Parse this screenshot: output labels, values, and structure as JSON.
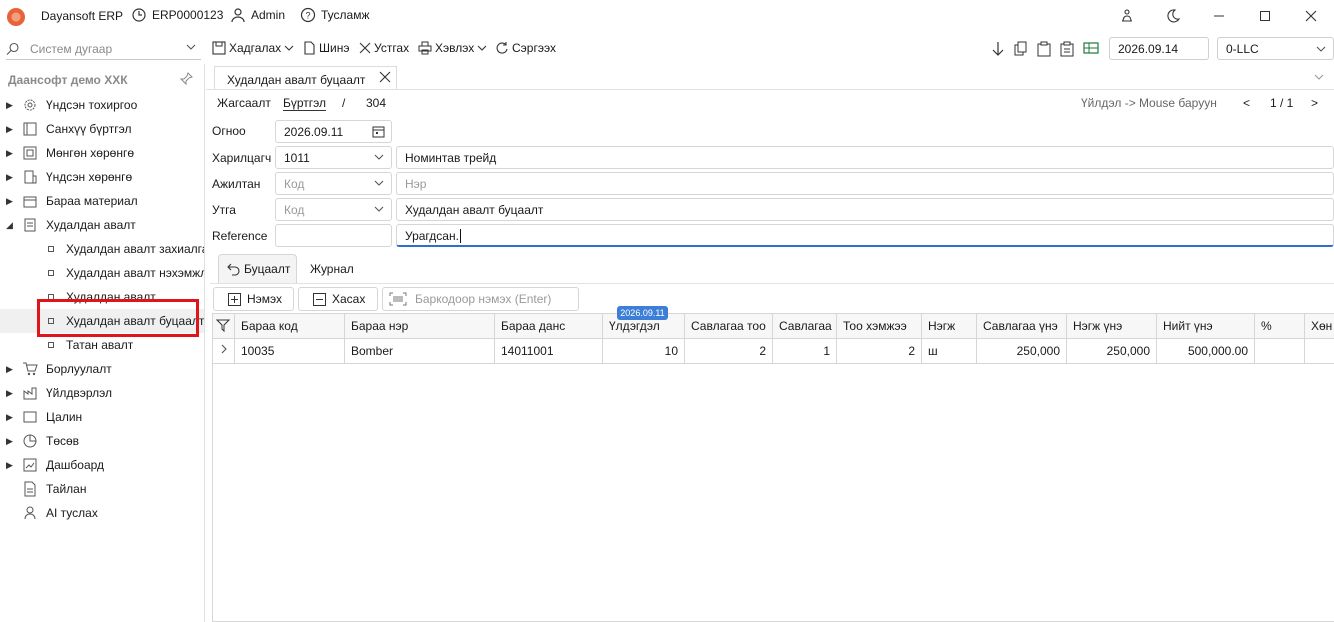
{
  "titlebar": {
    "app_name": "Dayansoft ERP",
    "doc_code": "ERP0000123",
    "user": "Admin",
    "help": "Тусламж"
  },
  "toolbar": {
    "search_placeholder": "Систем дугаар",
    "save": "Хадгалах",
    "new": "Шинэ",
    "delete": "Устгах",
    "print": "Хэвлэх",
    "refresh": "Сэргээх",
    "date": "2026.09.14",
    "company": "0-LLC"
  },
  "sidebar": {
    "title": "Даансофт демо ХХК",
    "items": [
      {
        "label": "Үндсэн тохиргоо",
        "icon": "gear-icon"
      },
      {
        "label": "Санхүү бүртгэл",
        "icon": "ledger-icon"
      },
      {
        "label": "Мөнгөн хөрөнгө",
        "icon": "cash-icon"
      },
      {
        "label": "Үндсэн хөрөнгө",
        "icon": "building-icon"
      },
      {
        "label": "Бараа материал",
        "icon": "box-icon"
      },
      {
        "label": "Худалдан авалт",
        "icon": "purchase-icon"
      }
    ],
    "sub_items": [
      {
        "label": "Худалдан авалт захиалга"
      },
      {
        "label": "Худалдан авалт нэхэмжлэх"
      },
      {
        "label": "Худалдан авалт"
      },
      {
        "label": "Худалдан авалт буцаалт"
      },
      {
        "label": "Татан авалт"
      }
    ],
    "items_after": [
      {
        "label": "Борлуулалт",
        "icon": "cart-icon"
      },
      {
        "label": "Үйлдвэрлэл",
        "icon": "factory-icon"
      },
      {
        "label": "Цалин",
        "icon": "salary-icon"
      },
      {
        "label": "Төсөв",
        "icon": "pie-icon"
      },
      {
        "label": "Дашбоард",
        "icon": "dashboard-icon"
      },
      {
        "label": "Тайлан",
        "icon": "report-icon"
      },
      {
        "label": "AI туслах",
        "icon": "ai-icon"
      }
    ]
  },
  "tab": {
    "title": "Худалдан авалт буцаалт"
  },
  "breadcrumb": {
    "list": "Жагсаалт",
    "register": "Бүртгэл",
    "sep": "/",
    "number": "304",
    "hint": "Үйлдэл -> Mouse баруун",
    "pager": "1 / 1"
  },
  "form": {
    "date_label": "Огноо",
    "date_value": "2026.09.11",
    "partner_label": "Харилцагч",
    "partner_code": "1011",
    "partner_name": "Номинтав трейд",
    "employee_label": "Ажилтан",
    "employee_code_ph": "Код",
    "employee_name_ph": "Нэр",
    "description_label": "Утга",
    "description_code_ph": "Код",
    "description_value": "Худалдан авалт буцаалт",
    "reference_label": "Reference",
    "reference_value": "Урагдсан."
  },
  "subtabs": {
    "active": "Буцаалт",
    "other": "Журнал"
  },
  "grid_actions": {
    "add": "Нэмэх",
    "remove": "Хасах",
    "barcode_placeholder": "Баркодоор нэмэх (Enter)",
    "date_badge": "2026.09.11"
  },
  "grid": {
    "columns": [
      "Бараа код",
      "Бараа нэр",
      "Бараа данс",
      "Үлдэгдэл",
      "Савлагаа тоо",
      "Савлагаа",
      "Тоо хэмжээ",
      "Нэгж",
      "Савлагаа үнэ",
      "Нэгж үнэ",
      "Нийт үнэ",
      "%",
      "Хөн"
    ],
    "rows": [
      [
        "10035",
        "Bomber",
        "14011001",
        "10",
        "2",
        "1",
        "2",
        "ш",
        "250,000",
        "250,000",
        "500,000.00",
        "",
        ""
      ]
    ]
  }
}
